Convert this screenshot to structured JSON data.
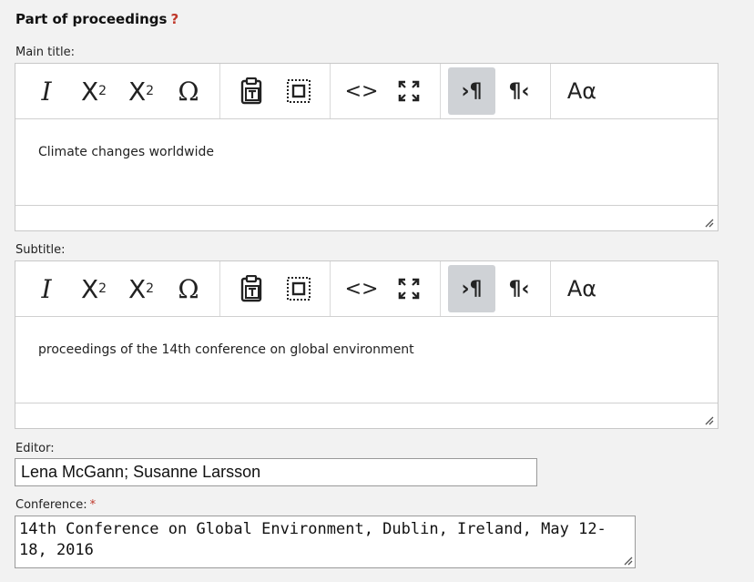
{
  "section": {
    "title": "Part of proceedings",
    "help": "?"
  },
  "toolbar": {
    "italic": "I",
    "subscript": {
      "base": "X",
      "script": "2"
    },
    "superscript": {
      "base": "X",
      "script": "2"
    },
    "special_char": "Ω",
    "source": "<>",
    "ltr": "›¶",
    "rtl": "¶‹",
    "font": "Aα"
  },
  "main_title": {
    "label": "Main title:",
    "value": "Climate changes worldwide"
  },
  "subtitle": {
    "label": "Subtitle:",
    "value": "proceedings of the 14th conference on global environment"
  },
  "editor": {
    "label": "Editor:",
    "value": "Lena McGann; Susanne Larsson"
  },
  "conference": {
    "label": "Conference:",
    "required_mark": "*",
    "value": "14th Conference on Global Environment, Dublin, Ireland, May 12-18, 2016"
  }
}
